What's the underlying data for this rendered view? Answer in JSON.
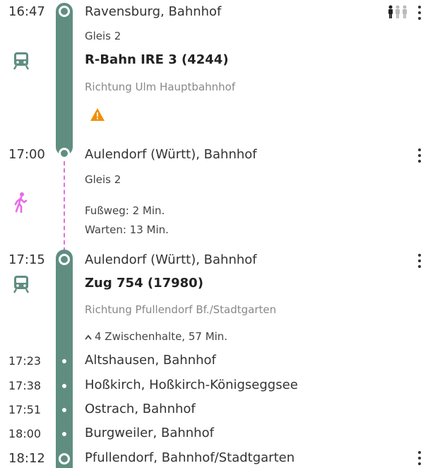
{
  "legs": [
    {
      "departure_time": "16:47",
      "departure_stop": "Ravensburg, Bahnhof",
      "platform": "Gleis 2",
      "train": "R-Bahn IRE 3 (4244)",
      "direction": "Richtung Ulm Hauptbahnhof",
      "arrival_time": "17:00",
      "arrival_stop": "Aulendorf (Württ), Bahnhof",
      "vehicle_icon": "train-icon",
      "occupancy_icon": "occupancy-icon",
      "warning_icon": "warning-icon"
    },
    {
      "arrival_platform": "Gleis 2",
      "walk": "Fußweg: 2 Min.",
      "wait": "Warten: 13 Min.",
      "icon": "walking-person-icon"
    },
    {
      "departure_time": "17:15",
      "departure_stop": "Aulendorf (Württ), Bahnhof",
      "train": "Zug 754 (17980)",
      "direction": "Richtung Pfullendorf Bf./Stadtgarten",
      "intermediate_toggle": "4 Zwischenhalte, 57 Min.",
      "intermediate_stops": [
        {
          "time": "17:23",
          "name": "Altshausen, Bahnhof"
        },
        {
          "time": "17:38",
          "name": "Hoßkirch, Hoßkirch-Königseggsee"
        },
        {
          "time": "17:51",
          "name": "Ostrach, Bahnhof"
        },
        {
          "time": "18:00",
          "name": "Burgweiler, Bahnhof"
        }
      ],
      "arrival_time": "18:12",
      "arrival_stop": "Pfullendorf, Bahnhof/Stadtgarten",
      "vehicle_icon": "train-icon"
    }
  ],
  "colors": {
    "line": "#5f8e81",
    "walk": "#e86be8",
    "warning": "#f0900a"
  }
}
